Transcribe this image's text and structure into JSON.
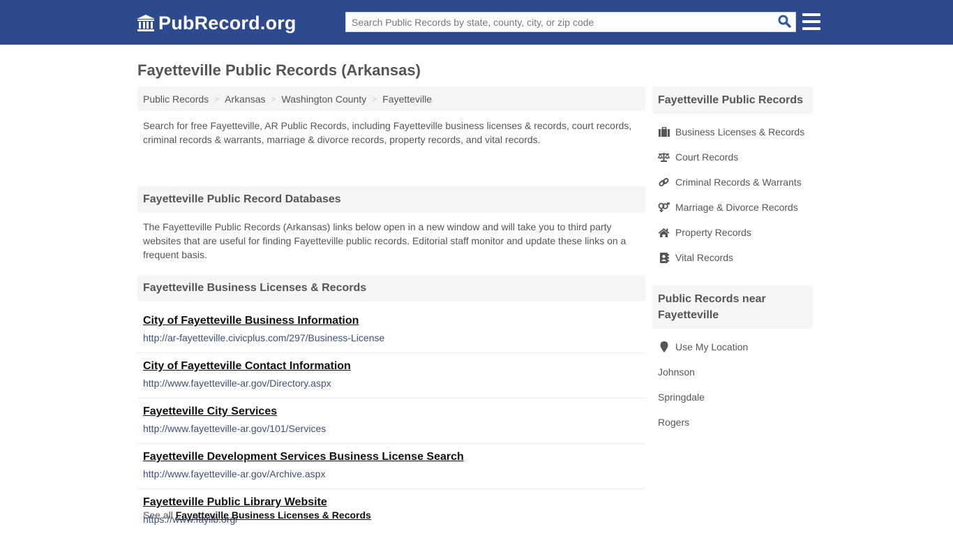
{
  "header": {
    "logo_text": "PubRecord.org",
    "logo_icon": "courthouse-icon",
    "search": {
      "placeholder": "Search Public Records by state, county, city, or zip code",
      "value": ""
    },
    "search_icon": "search-icon",
    "menu_icon": "hamburger-menu-icon",
    "brand_color": "#2d4a8f"
  },
  "page": {
    "title": "Fayetteville Public Records (Arkansas)"
  },
  "breadcrumb": [
    {
      "label": "Public Records"
    },
    {
      "label": "Arkansas"
    },
    {
      "label": "Washington County"
    },
    {
      "label": "Fayetteville"
    }
  ],
  "breadcrumb_separator": ">",
  "intro": "Search for free Fayetteville, AR Public Records, including Fayetteville business licenses & records, court records, criminal records & warrants, marriage & divorce records, property records, and vital records.",
  "databases": {
    "heading": "Fayetteville Public Record Databases",
    "description": "The Fayetteville Public Records (Arkansas) links below open in a new window and will take you to third party websites that are useful for finding Fayetteville public records. Editorial staff monitor and update these links on a frequent basis."
  },
  "business": {
    "heading": "Fayetteville Business Licenses & Records",
    "links": [
      {
        "title": "City of Fayetteville Business Information",
        "url": "http://ar-fayetteville.civicplus.com/297/Business-License"
      },
      {
        "title": "City of Fayetteville Contact Information",
        "url": "http://www.fayetteville-ar.gov/Directory.aspx"
      },
      {
        "title": "Fayetteville City Services",
        "url": "http://www.fayetteville-ar.gov/101/Services"
      },
      {
        "title": "Fayetteville Development Services Business License Search",
        "url": "http://www.fayetteville-ar.gov/Archive.aspx"
      },
      {
        "title": "Fayetteville Public Library Website",
        "url": "https://www.faylib.org/"
      }
    ],
    "see_all_prefix": "See all",
    "see_all_link": "Fayetteville Business Licenses & Records"
  },
  "sidebar": {
    "records_heading": "Fayetteville Public Records",
    "records": [
      {
        "label": "Business Licenses & Records",
        "icon": "briefcase-icon"
      },
      {
        "label": "Court Records",
        "icon": "balance-scale-icon"
      },
      {
        "label": "Criminal Records & Warrants",
        "icon": "link-icon"
      },
      {
        "label": "Marriage & Divorce Records",
        "icon": "venus-mars-icon"
      },
      {
        "label": "Property Records",
        "icon": "home-icon"
      },
      {
        "label": "Vital Records",
        "icon": "address-book-icon"
      }
    ],
    "nearby_heading": "Public Records near Fayetteville",
    "use_location": {
      "label": "Use My Location",
      "icon": "map-marker-icon"
    },
    "nearby": [
      {
        "label": "Johnson"
      },
      {
        "label": "Springdale"
      },
      {
        "label": "Rogers"
      }
    ]
  }
}
